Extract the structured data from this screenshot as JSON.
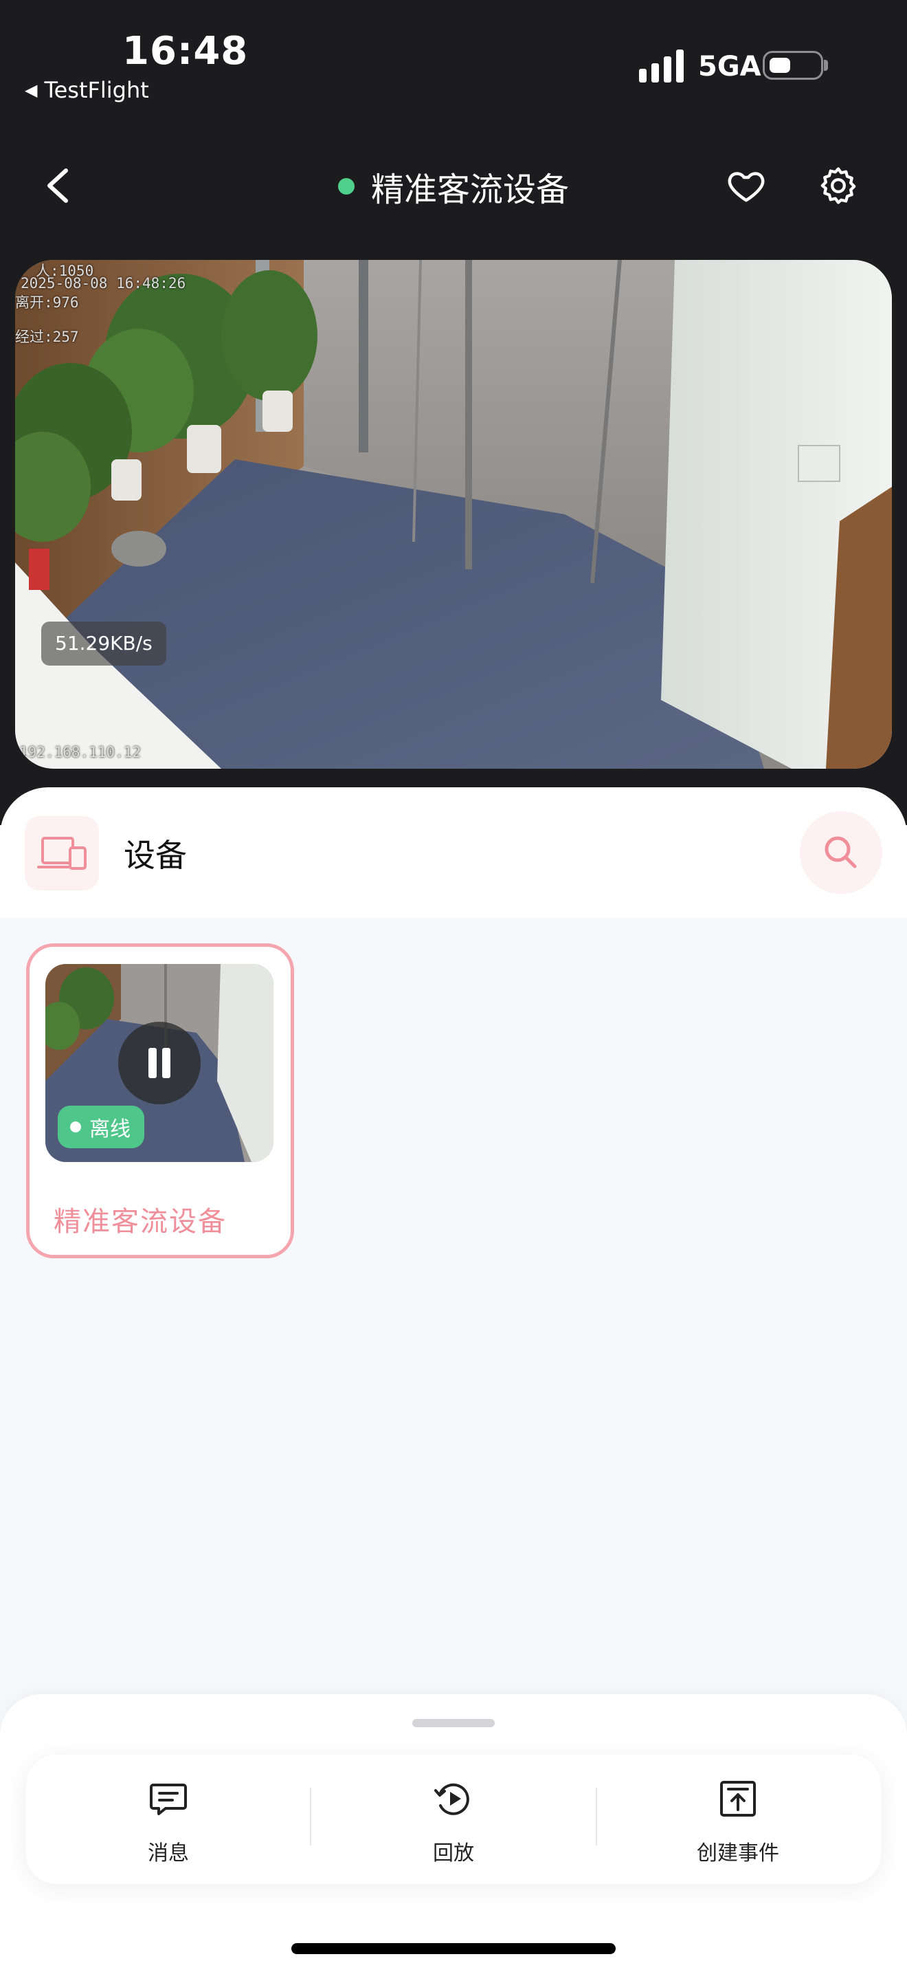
{
  "status_bar": {
    "time": "16:48",
    "back_app": "TestFlight",
    "network": "5GA",
    "battery_level": 0.3
  },
  "nav": {
    "title": "精准客流设备",
    "online_color": "#4fd18b",
    "icons": [
      "chevron-left-icon",
      "heart-icon",
      "gear-icon"
    ]
  },
  "video": {
    "osd_lines": [
      "人:1050",
      "2025-08-08 16:48:26",
      "离开:976",
      "经过:257"
    ],
    "osd_ip": "192.168.110.12",
    "speed": "51.29KB/s"
  },
  "device_section": {
    "label": "设备",
    "icons": [
      "devices-icon",
      "search-icon"
    ]
  },
  "device_card": {
    "name": "精准客流设备",
    "status": "离线",
    "accent": "#f4a5ad",
    "status_color": "#4fc78a"
  },
  "toolbar": {
    "items": [
      {
        "label": "消息",
        "icon": "message-icon"
      },
      {
        "label": "回放",
        "icon": "playback-icon"
      },
      {
        "label": "创建事件",
        "icon": "create-event-icon"
      }
    ]
  }
}
